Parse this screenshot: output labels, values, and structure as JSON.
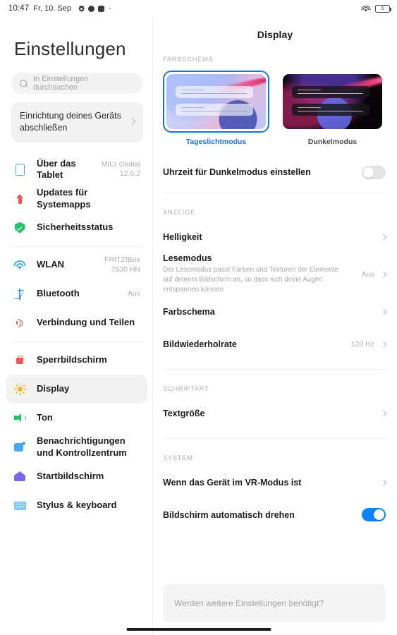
{
  "statusbar": {
    "time": "10:47",
    "date": "Fr, 10. Sep",
    "icons": [
      "gear-icon",
      "circle-icon",
      "rounded-square-icon",
      "dot-icon"
    ],
    "wifi_icon": "wifi-icon",
    "battery_level": "5",
    "battery_icon": "battery-icon"
  },
  "sidebar": {
    "title": "Einstellungen",
    "search": {
      "placeholder": "In Einstellungen durchsuchen",
      "icon": "search-icon"
    },
    "setup_card": {
      "label": "Einrichtung deines Geräts abschließen",
      "chevron": "chevron-right-icon"
    },
    "groups": [
      {
        "items": [
          {
            "label": "Über das Tablet",
            "value": "MIUI Global\n12.5.2",
            "icon": "tablet-icon",
            "selected": false
          },
          {
            "label": "Updates für Systemapps",
            "value": "",
            "icon": "update-arrow-icon",
            "selected": false
          },
          {
            "label": "Sicherheitsstatus",
            "value": "",
            "icon": "shield-check-icon",
            "selected": false
          }
        ]
      },
      {
        "items": [
          {
            "label": "WLAN",
            "value": "FRITZ!Box\n7530 HN",
            "icon": "wifi-icon",
            "selected": false
          },
          {
            "label": "Bluetooth",
            "value": "Aus",
            "icon": "bluetooth-icon",
            "selected": false
          },
          {
            "label": "Verbindung und Teilen",
            "value": "",
            "icon": "share-icon",
            "selected": false
          }
        ]
      },
      {
        "items": [
          {
            "label": "Sperrbildschirm",
            "value": "",
            "icon": "lock-icon",
            "selected": false
          },
          {
            "label": "Display",
            "value": "",
            "icon": "sun-icon",
            "selected": true
          },
          {
            "label": "Ton",
            "value": "",
            "icon": "speaker-icon",
            "selected": false
          },
          {
            "label": "Benachrichtigungen und Kontrollzentrum",
            "value": "",
            "icon": "notification-icon",
            "selected": false
          },
          {
            "label": "Startbildschirm",
            "value": "",
            "icon": "home-icon",
            "selected": false
          },
          {
            "label": "Stylus & keyboard",
            "value": "",
            "icon": "keyboard-icon",
            "selected": false
          }
        ]
      }
    ]
  },
  "main": {
    "title": "Display",
    "color_scheme": {
      "section_label": "FARBSCHEMA",
      "options": [
        {
          "name": "Tageslichtmodus",
          "selected": true
        },
        {
          "name": "Dunkelmodus",
          "selected": false
        }
      ],
      "dark_schedule": {
        "label": "Uhrzeit für Dunkelmodus einstellen",
        "toggle": "off"
      }
    },
    "display_section": {
      "section_label": "ANZEIGE",
      "rows": [
        {
          "title": "Helligkeit",
          "desc": "",
          "value": "",
          "chevron": true
        },
        {
          "title": "Lesemodus",
          "desc": "Der Lesemodus passt Farben und Texturen der Elemente auf deinem Bildschirm an, so dass sich deine Augen entspannen können",
          "value": "Aus",
          "chevron": true
        },
        {
          "title": "Farbschema",
          "desc": "",
          "value": "",
          "chevron": true
        },
        {
          "title": "Bildwiederholrate",
          "desc": "",
          "value": "120 Hz",
          "chevron": true
        }
      ]
    },
    "font_section": {
      "section_label": "SCHRIFTART",
      "rows": [
        {
          "title": "Textgröße",
          "desc": "",
          "value": "",
          "chevron": true
        }
      ]
    },
    "system_section": {
      "section_label": "SYSTEM",
      "rows": [
        {
          "title": "Wenn das Gerät im VR-Modus ist",
          "desc": "",
          "value": "",
          "chevron": true
        }
      ],
      "autorotate": {
        "label": "Bildschirm automatisch drehen",
        "toggle": "on"
      }
    },
    "feedback": {
      "text": "Werden weitere Einstellungen benötigt?"
    }
  },
  "colors": {
    "accent": "#1a73e8",
    "toggle_on": "#0a84ff",
    "selected_bg": "#f3f3f3"
  }
}
